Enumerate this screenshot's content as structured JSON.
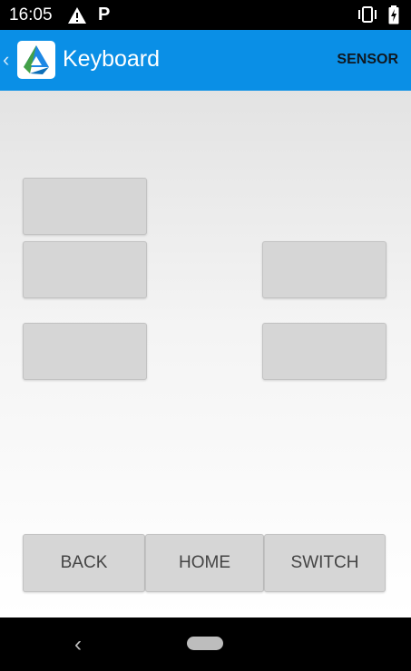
{
  "status_bar": {
    "time": "16:05",
    "icons": [
      "warning-icon",
      "p-icon",
      "vibrate-icon",
      "battery-charging-icon"
    ],
    "p_letter": "P"
  },
  "app_bar": {
    "title": "Keyboard",
    "action": "SENSOR",
    "back_glyph": "‹",
    "color": "#0a8fe6"
  },
  "keypad": {
    "key_color": "#d6d6d6"
  },
  "bottom_buttons": {
    "back": "BACK",
    "home": "HOME",
    "switch": "SWITCH"
  },
  "system_nav": {
    "back_glyph": "‹"
  }
}
